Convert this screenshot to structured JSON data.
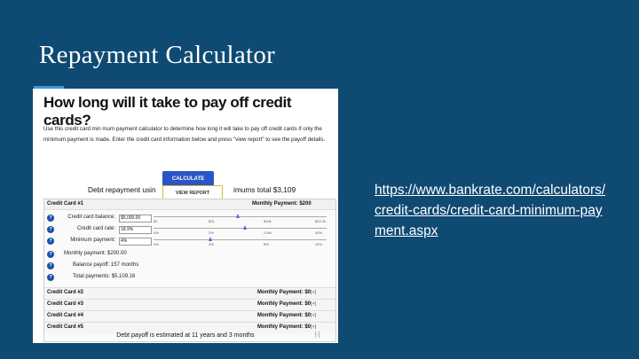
{
  "slide": {
    "title": "Repayment Calculator",
    "link": "https://www.bankrate.com/calculators/credit-cards/credit-card-minimum-payment.aspx"
  },
  "calculator": {
    "heading": "How long will it take to pay off credit cards?",
    "intro": "Use this credit card min mum payment calculator to determine how long it will take to pay off credit cards if only the minimum payment is made. Enter the credit card information below and press \"view report\" to see the payoff details.",
    "calculate_label": "CALCULATE",
    "view_report_label": "VIEW REPORT",
    "summary_left": "Debt repayment usin",
    "summary_right": "imums total $3,109",
    "card1": {
      "name": "Credit Card #1",
      "payment": "Monthly Payment: $200",
      "fields": [
        {
          "label": "Credit card balance:",
          "value": "$5,000.00",
          "scale": [
            "$1",
            "$7k",
            "$10k",
            "$12.2k"
          ]
        },
        {
          "label": "Credit card rate:",
          "value": "18.9%",
          "scale": [
            "0%",
            "2%",
            "2.8%",
            "30%"
          ]
        },
        {
          "label": "Minimum payment:",
          "value": "4%",
          "scale": [
            "0%",
            "4%",
            "8%",
            "12%"
          ]
        }
      ],
      "monthly_payment": "Monthly payment: $200.00",
      "balance_payoff": "Balance payoff: 157 months",
      "total_payments": "Total payments: $5,109.16"
    },
    "other_cards": [
      {
        "name": "Credit Card #2",
        "payment": "Monthly Payment: $0"
      },
      {
        "name": "Credit Card #3",
        "payment": "Monthly Payment: $0"
      },
      {
        "name": "Credit Card #4",
        "payment": "Monthly Payment: $0"
      },
      {
        "name": "Credit Card #5",
        "payment": "Monthly Payment: $0"
      }
    ],
    "footer": "Debt payoff is estimated at 11 years and 3 months",
    "row_control": "[+]",
    "footer_control": "[-]"
  },
  "colors": {
    "background": "#0f4a73",
    "accent": "#3b9bd8",
    "button": "#2a55c6"
  }
}
